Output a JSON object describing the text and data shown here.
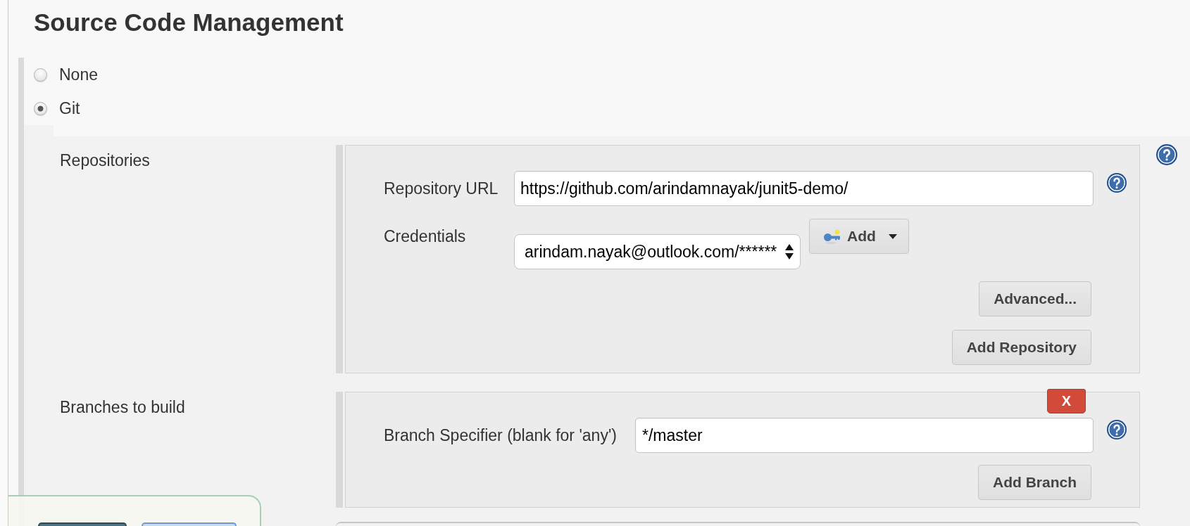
{
  "section": {
    "title": "Source Code Management"
  },
  "scm_options": [
    {
      "label": "None",
      "selected": false
    },
    {
      "label": "Git",
      "selected": true
    }
  ],
  "repositories": {
    "label": "Repositories",
    "url_field": {
      "label": "Repository URL",
      "value": "https://github.com/arindamnayak/junit5-demo/"
    },
    "credentials_field": {
      "label": "Credentials",
      "value": "arindam.nayak@outlook.com/******",
      "add_button": "Add"
    },
    "advanced_button": "Advanced...",
    "add_repository_button": "Add Repository"
  },
  "branches": {
    "label": "Branches to build",
    "remove_button": "X",
    "branch_specifier": {
      "label": "Branch Specifier (blank for 'any')",
      "value": "*/master"
    },
    "add_branch_button": "Add Branch"
  }
}
